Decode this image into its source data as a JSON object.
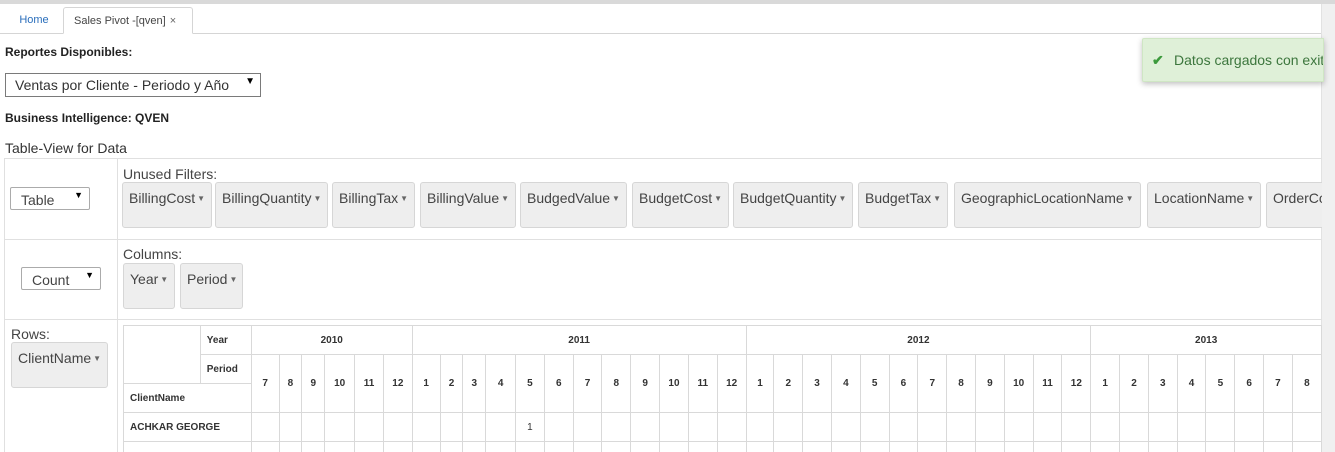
{
  "tabs": [
    {
      "label": "Home"
    },
    {
      "label": "Sales Pivot -[qven]",
      "close": "×"
    }
  ],
  "reports_label": "Reportes Disponibles:",
  "report_select": {
    "value": "Ventas por Cliente - Periodo y Año"
  },
  "bi_label": "Business Intelligence: QVEN",
  "table_view_title": "Table-View for Data",
  "toast": {
    "message": "Datos cargados con exito",
    "icon": "check-icon",
    "color": "#dff0d8"
  },
  "pivot": {
    "renderer": "Table",
    "aggregator": "Count",
    "unused_label": "Unused Filters:",
    "unused": [
      "BillingCost",
      "BillingQuantity",
      "BillingTax",
      "BillingValue",
      "BudgedValue",
      "BudgetCost",
      "BudgetQuantity",
      "BudgetTax",
      "GeographicLocationName",
      "LocationName",
      "OrderCost"
    ],
    "columns_label": "Columns:",
    "columns": [
      "Year",
      "Period"
    ],
    "rows_label": "Rows:",
    "rows": [
      "ClientName"
    ],
    "table": {
      "year_header": "Year",
      "period_header": "Period",
      "row_header": "ClientName",
      "years": [
        {
          "year": "2010",
          "periods": [
            "7",
            "8",
            "9",
            "10",
            "11",
            "12"
          ]
        },
        {
          "year": "2011",
          "periods": [
            "1",
            "2",
            "3",
            "4",
            "5",
            "6",
            "7",
            "8",
            "9",
            "10",
            "11",
            "12"
          ]
        },
        {
          "year": "2012",
          "periods": [
            "1",
            "2",
            "3",
            "4",
            "5",
            "6",
            "7",
            "8",
            "9",
            "10",
            "11",
            "12"
          ]
        },
        {
          "year": "2013",
          "periods": [
            "1",
            "2",
            "3",
            "4",
            "5",
            "6",
            "7",
            "8"
          ]
        }
      ],
      "rows": [
        {
          "client": "ACHKAR GEORGE",
          "cells": {
            "2011-5": "1"
          }
        },
        {
          "client": "",
          "cells": {}
        }
      ]
    }
  }
}
